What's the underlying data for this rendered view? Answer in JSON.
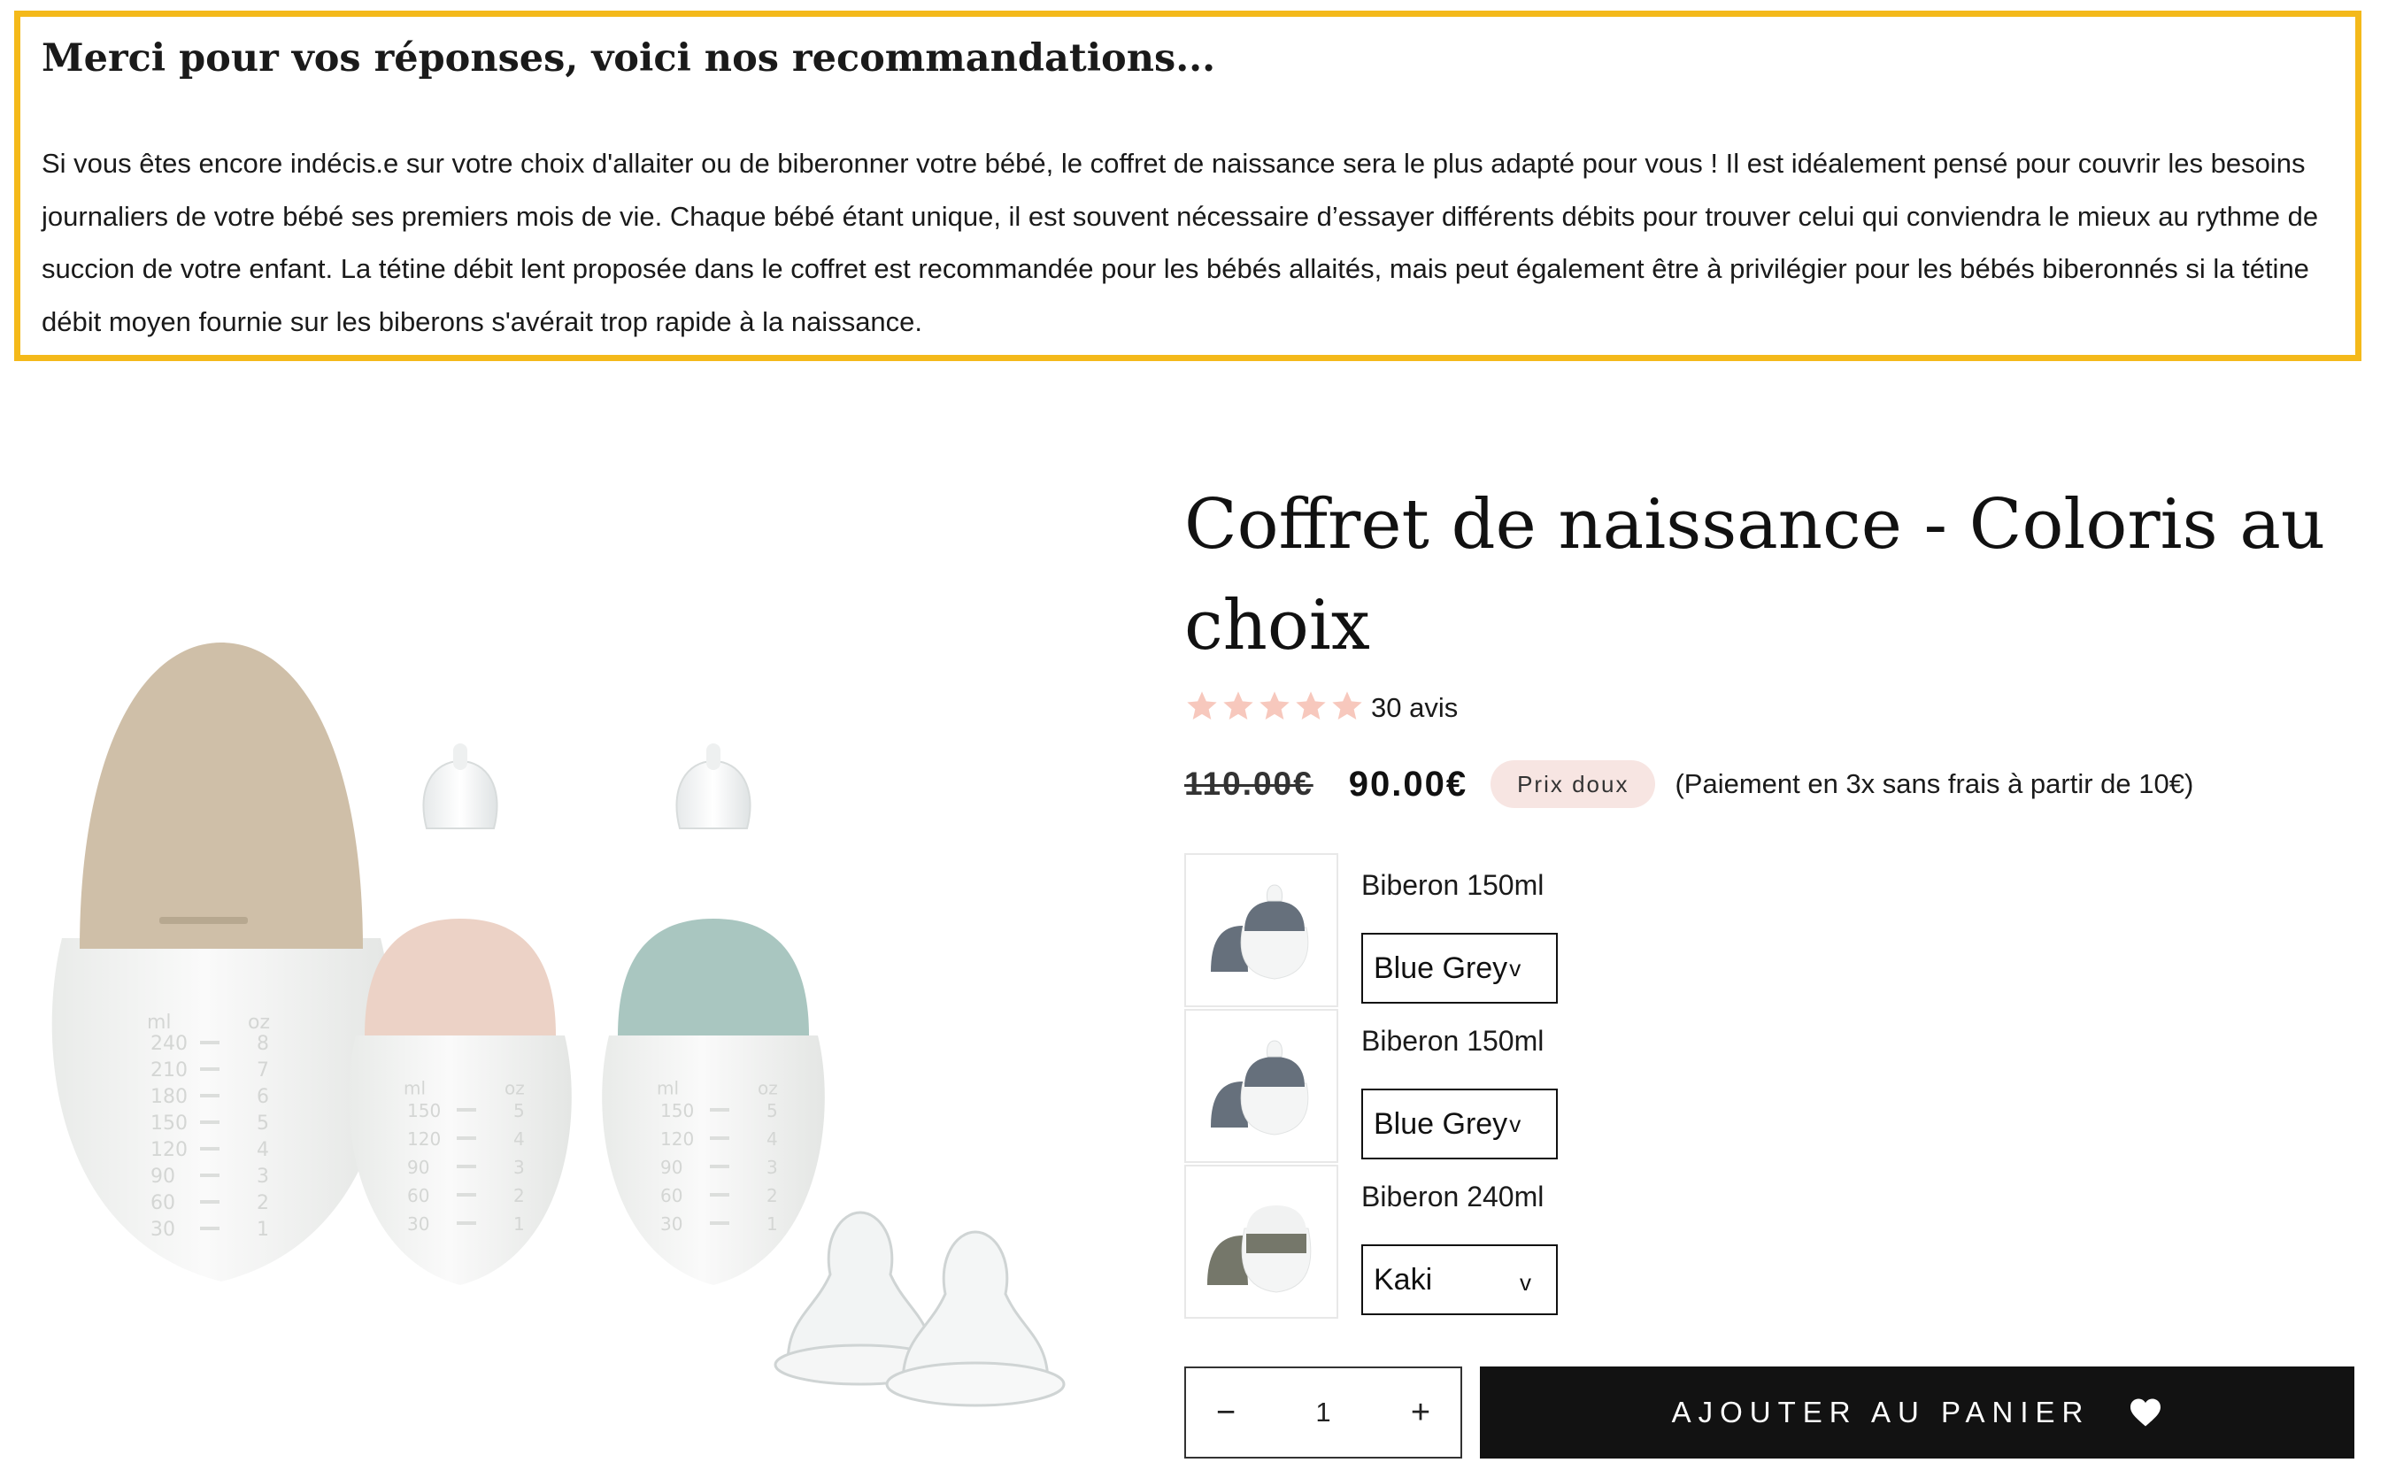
{
  "recommendation": {
    "title": "Merci pour vos réponses, voici nos recommandations...",
    "text": "Si vous êtes encore indécis.e sur votre choix d'allaiter ou de biberonner votre bébé, le coffret de naissance sera le plus adapté pour vous ! Il est idéalement pensé pour couvrir les besoins journaliers de votre bébé ses premiers mois de vie. Chaque bébé étant unique, il est souvent nécessaire d’essayer différents débits pour trouver celui qui conviendra le mieux au rythme de succion de votre enfant. La tétine débit lent proposée dans le coffret est recommandée pour les bébés allaités, mais peut également être à privilégier pour les bébés biberonnés si la tétine débit moyen fournie sur les biberons s'avérait trop rapide à la naissance."
  },
  "product": {
    "title": "Coffret de naissance - Coloris au choix",
    "rating_stars": 5,
    "reviews_label": "30 avis",
    "old_price": "110.00€",
    "price": "90.00€",
    "badge": "Prix doux",
    "installments": "(Paiement en 3x sans frais à partir de 10€)",
    "image_scale_labels": {
      "big_units": [
        "ml",
        "oz"
      ],
      "big_ml": [
        "240",
        "210",
        "180",
        "150",
        "120",
        "90",
        "60",
        "30"
      ],
      "big_oz": [
        "8",
        "7",
        "6",
        "5",
        "4",
        "3",
        "2",
        "1"
      ],
      "small_ml": [
        "150",
        "120",
        "90",
        "60",
        "30"
      ],
      "small_oz": [
        "5",
        "4",
        "3",
        "2",
        "1"
      ]
    },
    "variants": [
      {
        "name": "Biberon 150ml",
        "selected": "Blue Grey",
        "chevron": "v"
      },
      {
        "name": "Biberon 150ml",
        "selected": "Blue Grey",
        "chevron": "v"
      },
      {
        "name": "Biberon 240ml",
        "selected": "Kaki",
        "chevron": "v"
      }
    ],
    "quantity": {
      "minus": "−",
      "value": "1",
      "plus": "+"
    },
    "add_to_cart_label": "AJOUTER AU PANIER"
  },
  "colors": {
    "highlight_border": "#f4b91a",
    "star": "#f7c8bd",
    "badge_bg": "#f7e5e2",
    "cap_beige": "#cfbfa8",
    "cap_pink": "#ecd2c6",
    "cap_sage": "#a9c6c0",
    "blue_grey": "#66707c",
    "kaki": "#75776a"
  }
}
